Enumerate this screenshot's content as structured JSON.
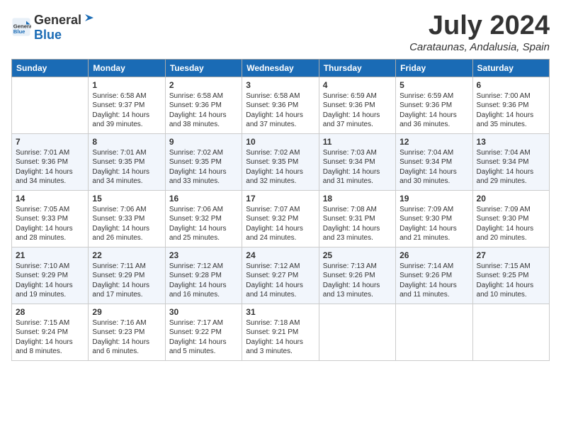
{
  "header": {
    "logo_general": "General",
    "logo_blue": "Blue",
    "month_title": "July 2024",
    "subtitle": "Carataunas, Andalusia, Spain"
  },
  "days_of_week": [
    "Sunday",
    "Monday",
    "Tuesday",
    "Wednesday",
    "Thursday",
    "Friday",
    "Saturday"
  ],
  "weeks": [
    [
      {
        "day": "",
        "sunrise": "",
        "sunset": "",
        "daylight": ""
      },
      {
        "day": "1",
        "sunrise": "Sunrise: 6:58 AM",
        "sunset": "Sunset: 9:37 PM",
        "daylight": "Daylight: 14 hours and 39 minutes."
      },
      {
        "day": "2",
        "sunrise": "Sunrise: 6:58 AM",
        "sunset": "Sunset: 9:36 PM",
        "daylight": "Daylight: 14 hours and 38 minutes."
      },
      {
        "day": "3",
        "sunrise": "Sunrise: 6:58 AM",
        "sunset": "Sunset: 9:36 PM",
        "daylight": "Daylight: 14 hours and 37 minutes."
      },
      {
        "day": "4",
        "sunrise": "Sunrise: 6:59 AM",
        "sunset": "Sunset: 9:36 PM",
        "daylight": "Daylight: 14 hours and 37 minutes."
      },
      {
        "day": "5",
        "sunrise": "Sunrise: 6:59 AM",
        "sunset": "Sunset: 9:36 PM",
        "daylight": "Daylight: 14 hours and 36 minutes."
      },
      {
        "day": "6",
        "sunrise": "Sunrise: 7:00 AM",
        "sunset": "Sunset: 9:36 PM",
        "daylight": "Daylight: 14 hours and 35 minutes."
      }
    ],
    [
      {
        "day": "7",
        "sunrise": "Sunrise: 7:01 AM",
        "sunset": "Sunset: 9:36 PM",
        "daylight": "Daylight: 14 hours and 34 minutes."
      },
      {
        "day": "8",
        "sunrise": "Sunrise: 7:01 AM",
        "sunset": "Sunset: 9:35 PM",
        "daylight": "Daylight: 14 hours and 34 minutes."
      },
      {
        "day": "9",
        "sunrise": "Sunrise: 7:02 AM",
        "sunset": "Sunset: 9:35 PM",
        "daylight": "Daylight: 14 hours and 33 minutes."
      },
      {
        "day": "10",
        "sunrise": "Sunrise: 7:02 AM",
        "sunset": "Sunset: 9:35 PM",
        "daylight": "Daylight: 14 hours and 32 minutes."
      },
      {
        "day": "11",
        "sunrise": "Sunrise: 7:03 AM",
        "sunset": "Sunset: 9:34 PM",
        "daylight": "Daylight: 14 hours and 31 minutes."
      },
      {
        "day": "12",
        "sunrise": "Sunrise: 7:04 AM",
        "sunset": "Sunset: 9:34 PM",
        "daylight": "Daylight: 14 hours and 30 minutes."
      },
      {
        "day": "13",
        "sunrise": "Sunrise: 7:04 AM",
        "sunset": "Sunset: 9:34 PM",
        "daylight": "Daylight: 14 hours and 29 minutes."
      }
    ],
    [
      {
        "day": "14",
        "sunrise": "Sunrise: 7:05 AM",
        "sunset": "Sunset: 9:33 PM",
        "daylight": "Daylight: 14 hours and 28 minutes."
      },
      {
        "day": "15",
        "sunrise": "Sunrise: 7:06 AM",
        "sunset": "Sunset: 9:33 PM",
        "daylight": "Daylight: 14 hours and 26 minutes."
      },
      {
        "day": "16",
        "sunrise": "Sunrise: 7:06 AM",
        "sunset": "Sunset: 9:32 PM",
        "daylight": "Daylight: 14 hours and 25 minutes."
      },
      {
        "day": "17",
        "sunrise": "Sunrise: 7:07 AM",
        "sunset": "Sunset: 9:32 PM",
        "daylight": "Daylight: 14 hours and 24 minutes."
      },
      {
        "day": "18",
        "sunrise": "Sunrise: 7:08 AM",
        "sunset": "Sunset: 9:31 PM",
        "daylight": "Daylight: 14 hours and 23 minutes."
      },
      {
        "day": "19",
        "sunrise": "Sunrise: 7:09 AM",
        "sunset": "Sunset: 9:30 PM",
        "daylight": "Daylight: 14 hours and 21 minutes."
      },
      {
        "day": "20",
        "sunrise": "Sunrise: 7:09 AM",
        "sunset": "Sunset: 9:30 PM",
        "daylight": "Daylight: 14 hours and 20 minutes."
      }
    ],
    [
      {
        "day": "21",
        "sunrise": "Sunrise: 7:10 AM",
        "sunset": "Sunset: 9:29 PM",
        "daylight": "Daylight: 14 hours and 19 minutes."
      },
      {
        "day": "22",
        "sunrise": "Sunrise: 7:11 AM",
        "sunset": "Sunset: 9:29 PM",
        "daylight": "Daylight: 14 hours and 17 minutes."
      },
      {
        "day": "23",
        "sunrise": "Sunrise: 7:12 AM",
        "sunset": "Sunset: 9:28 PM",
        "daylight": "Daylight: 14 hours and 16 minutes."
      },
      {
        "day": "24",
        "sunrise": "Sunrise: 7:12 AM",
        "sunset": "Sunset: 9:27 PM",
        "daylight": "Daylight: 14 hours and 14 minutes."
      },
      {
        "day": "25",
        "sunrise": "Sunrise: 7:13 AM",
        "sunset": "Sunset: 9:26 PM",
        "daylight": "Daylight: 14 hours and 13 minutes."
      },
      {
        "day": "26",
        "sunrise": "Sunrise: 7:14 AM",
        "sunset": "Sunset: 9:26 PM",
        "daylight": "Daylight: 14 hours and 11 minutes."
      },
      {
        "day": "27",
        "sunrise": "Sunrise: 7:15 AM",
        "sunset": "Sunset: 9:25 PM",
        "daylight": "Daylight: 14 hours and 10 minutes."
      }
    ],
    [
      {
        "day": "28",
        "sunrise": "Sunrise: 7:15 AM",
        "sunset": "Sunset: 9:24 PM",
        "daylight": "Daylight: 14 hours and 8 minutes."
      },
      {
        "day": "29",
        "sunrise": "Sunrise: 7:16 AM",
        "sunset": "Sunset: 9:23 PM",
        "daylight": "Daylight: 14 hours and 6 minutes."
      },
      {
        "day": "30",
        "sunrise": "Sunrise: 7:17 AM",
        "sunset": "Sunset: 9:22 PM",
        "daylight": "Daylight: 14 hours and 5 minutes."
      },
      {
        "day": "31",
        "sunrise": "Sunrise: 7:18 AM",
        "sunset": "Sunset: 9:21 PM",
        "daylight": "Daylight: 14 hours and 3 minutes."
      },
      {
        "day": "",
        "sunrise": "",
        "sunset": "",
        "daylight": ""
      },
      {
        "day": "",
        "sunrise": "",
        "sunset": "",
        "daylight": ""
      },
      {
        "day": "",
        "sunrise": "",
        "sunset": "",
        "daylight": ""
      }
    ]
  ],
  "colors": {
    "header_bg": "#1a6bb5",
    "header_text": "#ffffff",
    "even_row_bg": "#f2f6fc",
    "odd_row_bg": "#ffffff"
  }
}
